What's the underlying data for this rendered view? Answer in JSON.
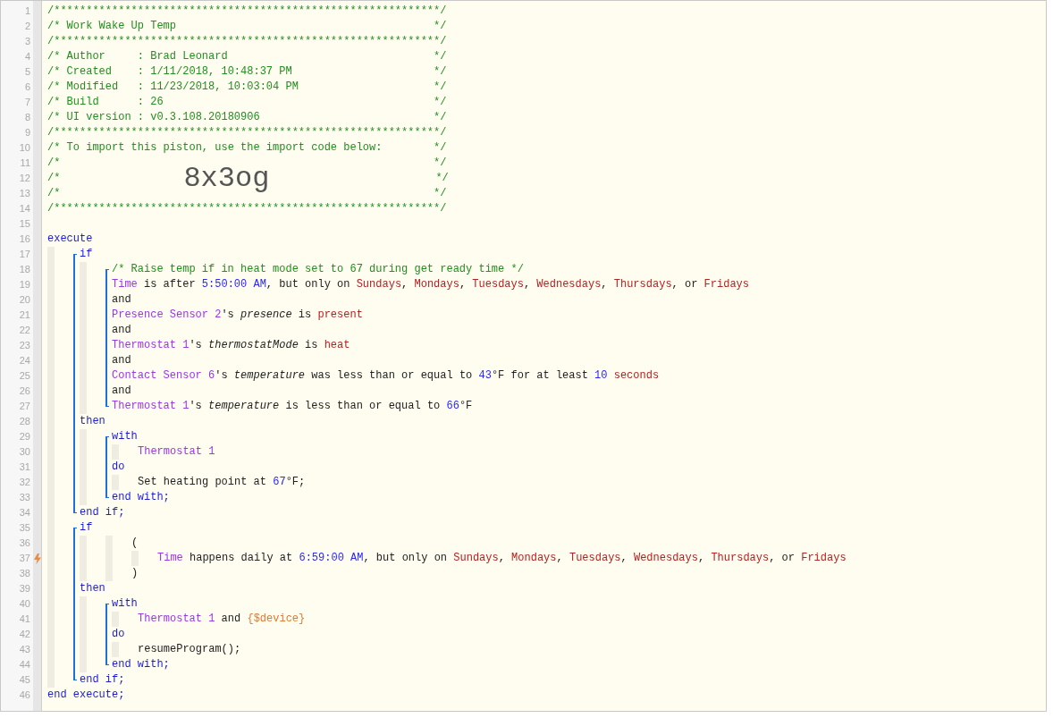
{
  "code": [
    {
      "kind": "line",
      "num": "1",
      "trigger": false,
      "tokens": [
        {
          "kind": "comment",
          "text": "/************************************************************/"
        }
      ]
    },
    {
      "kind": "line",
      "num": "2",
      "trigger": false,
      "tokens": [
        {
          "kind": "comment",
          "text": "/* Work Wake Up Temp                                        */"
        }
      ]
    },
    {
      "kind": "line",
      "num": "3",
      "trigger": false,
      "tokens": [
        {
          "kind": "comment",
          "text": "/************************************************************/"
        }
      ]
    },
    {
      "kind": "line",
      "num": "4",
      "trigger": false,
      "tokens": [
        {
          "kind": "comment",
          "text": "/* Author     : Brad Leonard                                */"
        }
      ]
    },
    {
      "kind": "line",
      "num": "5",
      "trigger": false,
      "tokens": [
        {
          "kind": "comment",
          "text": "/* Created    : 1/11/2018, 10:48:37 PM                      */"
        }
      ]
    },
    {
      "kind": "line",
      "num": "6",
      "trigger": false,
      "tokens": [
        {
          "kind": "comment",
          "text": "/* Modified   : 11/23/2018, 10:03:04 PM                     */"
        }
      ]
    },
    {
      "kind": "line",
      "num": "7",
      "trigger": false,
      "tokens": [
        {
          "kind": "comment",
          "text": "/* Build      : 26                                          */"
        }
      ]
    },
    {
      "kind": "line",
      "num": "8",
      "trigger": false,
      "tokens": [
        {
          "kind": "comment",
          "text": "/* UI version : v0.3.108.20180906                           */"
        }
      ]
    },
    {
      "kind": "line",
      "num": "9",
      "trigger": false,
      "tokens": [
        {
          "kind": "comment",
          "text": "/************************************************************/"
        }
      ]
    },
    {
      "kind": "line",
      "num": "10",
      "trigger": false,
      "tokens": [
        {
          "kind": "comment",
          "text": "/* To import this piston, use the import code below:        */"
        }
      ]
    },
    {
      "kind": "line",
      "num": "11",
      "trigger": false,
      "tokens": [
        {
          "kind": "comment",
          "text": "/*                                                          */"
        }
      ]
    },
    {
      "kind": "line",
      "num": "12",
      "trigger": false,
      "tokens": [
        {
          "kind": "comment",
          "text": "/*"
        },
        {
          "kind": "import-code",
          "text": "8x3og"
        },
        {
          "kind": "comment",
          "text": "*/"
        }
      ]
    },
    {
      "kind": "line",
      "num": "13",
      "trigger": false,
      "tokens": [
        {
          "kind": "comment",
          "text": "/*                                                          */"
        }
      ]
    },
    {
      "kind": "line",
      "num": "14",
      "trigger": false,
      "tokens": [
        {
          "kind": "comment",
          "text": "/************************************************************/"
        }
      ]
    },
    {
      "kind": "line",
      "num": "15",
      "trigger": false
    },
    {
      "kind": "line",
      "num": "16",
      "trigger": false,
      "tokens": [
        {
          "kind": "keyword",
          "text": "execute"
        }
      ]
    },
    {
      "kind": "indent",
      "children": [
        {
          "kind": "block",
          "children": [
            {
              "kind": "line",
              "num": "17",
              "trigger": false,
              "tokens": [
                {
                  "kind": "keyword",
                  "text": "if"
                }
              ]
            },
            {
              "kind": "indent",
              "children": [
                {
                  "kind": "block",
                  "children": [
                    {
                      "kind": "line",
                      "num": "18",
                      "trigger": false,
                      "tokens": [
                        {
                          "kind": "comment",
                          "text": "/* Raise temp if in heat mode set to 67 during get ready time */"
                        }
                      ]
                    },
                    {
                      "kind": "line",
                      "num": "19",
                      "trigger": false,
                      "tokens": [
                        {
                          "kind": "device",
                          "text": "Time"
                        },
                        {
                          "kind": "plain",
                          "text": " is after "
                        },
                        {
                          "kind": "number",
                          "text": "5:50:00 AM"
                        },
                        {
                          "kind": "plain",
                          "text": ", but only on "
                        },
                        {
                          "kind": "value",
                          "text": "Sundays"
                        },
                        {
                          "kind": "plain",
                          "text": ", "
                        },
                        {
                          "kind": "value",
                          "text": "Mondays"
                        },
                        {
                          "kind": "plain",
                          "text": ", "
                        },
                        {
                          "kind": "value",
                          "text": "Tuesdays"
                        },
                        {
                          "kind": "plain",
                          "text": ", "
                        },
                        {
                          "kind": "value",
                          "text": "Wednesdays"
                        },
                        {
                          "kind": "plain",
                          "text": ", "
                        },
                        {
                          "kind": "value",
                          "text": "Thursdays"
                        },
                        {
                          "kind": "plain",
                          "text": ", or "
                        },
                        {
                          "kind": "value",
                          "text": "Fridays"
                        }
                      ]
                    },
                    {
                      "kind": "line",
                      "num": "20",
                      "trigger": false,
                      "tokens": [
                        {
                          "kind": "plain",
                          "text": "and"
                        }
                      ]
                    },
                    {
                      "kind": "line",
                      "num": "21",
                      "trigger": false,
                      "tokens": [
                        {
                          "kind": "device",
                          "text": "Presence Sensor 2"
                        },
                        {
                          "kind": "plain",
                          "text": "'s "
                        },
                        {
                          "kind": "attribute",
                          "text": "presence"
                        },
                        {
                          "kind": "plain",
                          "text": " is "
                        },
                        {
                          "kind": "value",
                          "text": "present"
                        }
                      ]
                    },
                    {
                      "kind": "line",
                      "num": "22",
                      "trigger": false,
                      "tokens": [
                        {
                          "kind": "plain",
                          "text": "and"
                        }
                      ]
                    },
                    {
                      "kind": "line",
                      "num": "23",
                      "trigger": false,
                      "tokens": [
                        {
                          "kind": "device",
                          "text": "Thermostat 1"
                        },
                        {
                          "kind": "plain",
                          "text": "'s "
                        },
                        {
                          "kind": "attribute",
                          "text": "thermostatMode"
                        },
                        {
                          "kind": "plain",
                          "text": " is "
                        },
                        {
                          "kind": "value",
                          "text": "heat"
                        }
                      ]
                    },
                    {
                      "kind": "line",
                      "num": "24",
                      "trigger": false,
                      "tokens": [
                        {
                          "kind": "plain",
                          "text": "and"
                        }
                      ]
                    },
                    {
                      "kind": "line",
                      "num": "25",
                      "trigger": false,
                      "tokens": [
                        {
                          "kind": "device",
                          "text": "Contact Sensor 6"
                        },
                        {
                          "kind": "plain",
                          "text": "'s "
                        },
                        {
                          "kind": "attribute",
                          "text": "temperature"
                        },
                        {
                          "kind": "plain",
                          "text": " was less than or equal to "
                        },
                        {
                          "kind": "number",
                          "text": "43"
                        },
                        {
                          "kind": "plain",
                          "text": "°F for at least "
                        },
                        {
                          "kind": "number",
                          "text": "10"
                        },
                        {
                          "kind": "value",
                          "text": " seconds"
                        }
                      ]
                    },
                    {
                      "kind": "line",
                      "num": "26",
                      "trigger": false,
                      "tokens": [
                        {
                          "kind": "plain",
                          "text": "and"
                        }
                      ]
                    },
                    {
                      "kind": "line",
                      "num": "27",
                      "trigger": false,
                      "tokens": [
                        {
                          "kind": "device",
                          "text": "Thermostat 1"
                        },
                        {
                          "kind": "plain",
                          "text": "'s "
                        },
                        {
                          "kind": "attribute",
                          "text": "temperature"
                        },
                        {
                          "kind": "plain",
                          "text": " is less than or equal to "
                        },
                        {
                          "kind": "number",
                          "text": "66"
                        },
                        {
                          "kind": "plain",
                          "text": "°F"
                        }
                      ]
                    }
                  ]
                }
              ]
            },
            {
              "kind": "line",
              "num": "28",
              "trigger": false,
              "tokens": [
                {
                  "kind": "keyword",
                  "text": "then"
                }
              ]
            },
            {
              "kind": "indent",
              "children": [
                {
                  "kind": "block",
                  "children": [
                    {
                      "kind": "line",
                      "num": "29",
                      "trigger": false,
                      "tokens": [
                        {
                          "kind": "keyword",
                          "text": "with"
                        }
                      ]
                    },
                    {
                      "kind": "indent",
                      "children": [
                        {
                          "kind": "line",
                          "num": "30",
                          "trigger": false,
                          "tokens": [
                            {
                              "kind": "device",
                              "text": "Thermostat 1"
                            }
                          ]
                        }
                      ]
                    },
                    {
                      "kind": "line",
                      "num": "31",
                      "trigger": false,
                      "tokens": [
                        {
                          "kind": "keyword",
                          "text": "do"
                        }
                      ]
                    },
                    {
                      "kind": "indent",
                      "children": [
                        {
                          "kind": "line",
                          "num": "32",
                          "trigger": false,
                          "tokens": [
                            {
                              "kind": "plain",
                              "text": "Set heating point at "
                            },
                            {
                              "kind": "number",
                              "text": "67"
                            },
                            {
                              "kind": "plain",
                              "text": "°F;"
                            }
                          ]
                        }
                      ]
                    },
                    {
                      "kind": "line",
                      "num": "33",
                      "trigger": false,
                      "tokens": [
                        {
                          "kind": "keyword",
                          "text": "end with;"
                        }
                      ]
                    }
                  ]
                }
              ]
            },
            {
              "kind": "line",
              "num": "34",
              "trigger": false,
              "tokens": [
                {
                  "kind": "keyword",
                  "text": "end if;"
                }
              ]
            }
          ]
        },
        {
          "kind": "block",
          "children": [
            {
              "kind": "line",
              "num": "35",
              "trigger": false,
              "tokens": [
                {
                  "kind": "keyword",
                  "text": "if"
                }
              ]
            },
            {
              "kind": "indent",
              "children": [
                {
                  "kind": "indent",
                  "children": [
                    {
                      "kind": "line",
                      "num": "36",
                      "trigger": false,
                      "tokens": [
                        {
                          "kind": "plain",
                          "text": "("
                        }
                      ]
                    },
                    {
                      "kind": "indent",
                      "children": [
                        {
                          "kind": "line",
                          "num": "37",
                          "trigger": true,
                          "tokens": [
                            {
                              "kind": "device",
                              "text": "Time"
                            },
                            {
                              "kind": "plain",
                              "text": " happens daily at "
                            },
                            {
                              "kind": "number",
                              "text": "6:59:00 AM"
                            },
                            {
                              "kind": "plain",
                              "text": ", but only on "
                            },
                            {
                              "kind": "value",
                              "text": "Sundays"
                            },
                            {
                              "kind": "plain",
                              "text": ", "
                            },
                            {
                              "kind": "value",
                              "text": "Mondays"
                            },
                            {
                              "kind": "plain",
                              "text": ", "
                            },
                            {
                              "kind": "value",
                              "text": "Tuesdays"
                            },
                            {
                              "kind": "plain",
                              "text": ", "
                            },
                            {
                              "kind": "value",
                              "text": "Wednesdays"
                            },
                            {
                              "kind": "plain",
                              "text": ", "
                            },
                            {
                              "kind": "value",
                              "text": "Thursdays"
                            },
                            {
                              "kind": "plain",
                              "text": ", or "
                            },
                            {
                              "kind": "value",
                              "text": "Fridays"
                            }
                          ]
                        }
                      ]
                    },
                    {
                      "kind": "line",
                      "num": "38",
                      "trigger": false,
                      "tokens": [
                        {
                          "kind": "plain",
                          "text": ")"
                        }
                      ]
                    }
                  ]
                }
              ]
            },
            {
              "kind": "line",
              "num": "39",
              "trigger": false,
              "tokens": [
                {
                  "kind": "keyword",
                  "text": "then"
                }
              ]
            },
            {
              "kind": "indent",
              "children": [
                {
                  "kind": "block",
                  "children": [
                    {
                      "kind": "line",
                      "num": "40",
                      "trigger": false,
                      "tokens": [
                        {
                          "kind": "keyword",
                          "text": "with"
                        }
                      ]
                    },
                    {
                      "kind": "indent",
                      "children": [
                        {
                          "kind": "line",
                          "num": "41",
                          "trigger": false,
                          "tokens": [
                            {
                              "kind": "device",
                              "text": "Thermostat 1"
                            },
                            {
                              "kind": "plain",
                              "text": " and "
                            },
                            {
                              "kind": "variable",
                              "text": "{$device}"
                            }
                          ]
                        }
                      ]
                    },
                    {
                      "kind": "line",
                      "num": "42",
                      "trigger": false,
                      "tokens": [
                        {
                          "kind": "keyword",
                          "text": "do"
                        }
                      ]
                    },
                    {
                      "kind": "indent",
                      "children": [
                        {
                          "kind": "line",
                          "num": "43",
                          "trigger": false,
                          "tokens": [
                            {
                              "kind": "plain",
                              "text": "resumeProgram();"
                            }
                          ]
                        }
                      ]
                    },
                    {
                      "kind": "line",
                      "num": "44",
                      "trigger": false,
                      "tokens": [
                        {
                          "kind": "keyword",
                          "text": "end with;"
                        }
                      ]
                    }
                  ]
                }
              ]
            },
            {
              "kind": "line",
              "num": "45",
              "trigger": false,
              "tokens": [
                {
                  "kind": "keyword",
                  "text": "end if;"
                }
              ]
            }
          ]
        }
      ]
    },
    {
      "kind": "line",
      "num": "46",
      "trigger": false,
      "tokens": [
        {
          "kind": "keyword",
          "text": "end execute;"
        }
      ]
    }
  ]
}
